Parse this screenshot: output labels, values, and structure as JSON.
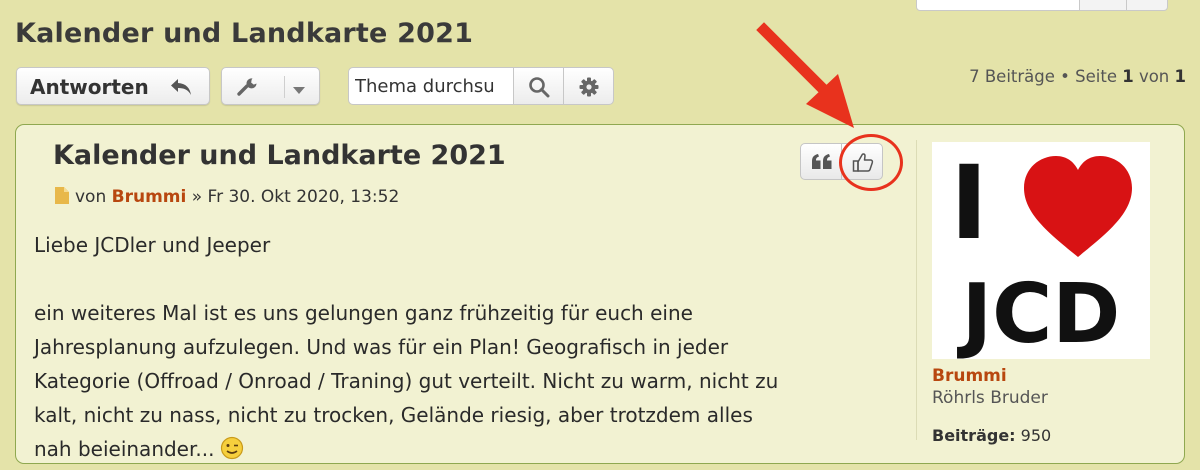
{
  "topic": {
    "title": "Kalender und Landkarte 2021"
  },
  "toolbar": {
    "reply_label": "Antworten",
    "search_value": "Thema durchsu",
    "pagination_count": "7 Beiträge",
    "pagination_separator": " • ",
    "pagination_page_word": "Seite ",
    "pagination_current": "1",
    "pagination_of": " von ",
    "pagination_total": "1"
  },
  "post": {
    "title": "Kalender und Landkarte 2021",
    "by": "von ",
    "author": "Brummi",
    "date": " » Fr 30. Okt 2020, 13:52",
    "body": {
      "greeting": "Liebe JCDler und Jeeper",
      "line1": "ein weiteres Mal ist es uns gelungen ganz frühzeitig für euch eine",
      "line2": "Jahresplanung aufzulegen. Und was für ein Plan! Geografisch in jeder",
      "line3": "Kategorie (Offroad / Onroad / Traning) gut verteilt. Nicht zu warm, nicht zu",
      "line4": "kalt, nicht zu nass, nicht zu trocken, Gelände riesig, aber trotzdem alles",
      "line5": "nah beieinander..."
    }
  },
  "profile": {
    "name": "Brummi",
    "rank": "Röhrls Bruder",
    "posts_label": "Beiträge:",
    "posts_value": "950",
    "avatar_top": "I",
    "avatar_bottom": "JCD"
  },
  "icons": {
    "reply": "reply-arrow-icon",
    "tools": "wrench-icon",
    "search": "search-icon",
    "advanced": "gear-icon",
    "quote": "quote-icon",
    "like": "thumbs-up-icon",
    "post": "document-icon"
  },
  "colors": {
    "page_bg": "#e4e3a9",
    "post_bg": "#f2f2d2",
    "post_border": "#8fa850",
    "username": "#b8470f",
    "annotation": "#e8321d"
  }
}
